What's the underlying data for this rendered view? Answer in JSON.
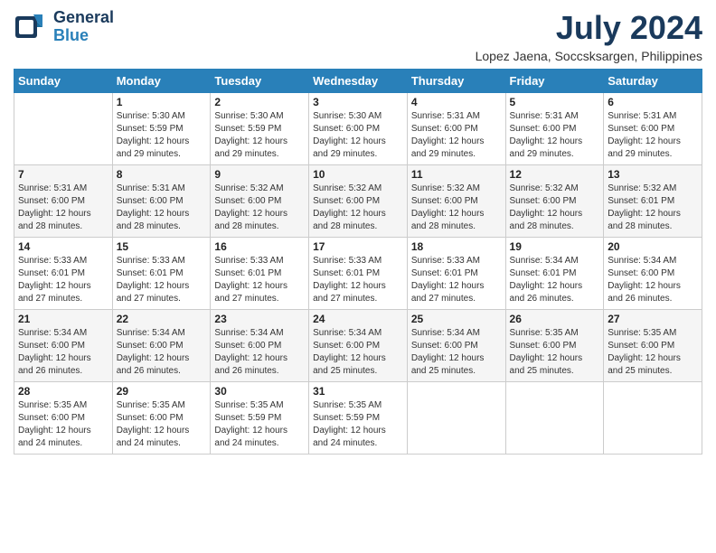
{
  "header": {
    "logo_general": "General",
    "logo_blue": "Blue",
    "month_year": "July 2024",
    "location": "Lopez Jaena, Soccsksargen, Philippines"
  },
  "calendar": {
    "days_of_week": [
      "Sunday",
      "Monday",
      "Tuesday",
      "Wednesday",
      "Thursday",
      "Friday",
      "Saturday"
    ],
    "weeks": [
      [
        {
          "day": "",
          "info": ""
        },
        {
          "day": "1",
          "info": "Sunrise: 5:30 AM\nSunset: 5:59 PM\nDaylight: 12 hours\nand 29 minutes."
        },
        {
          "day": "2",
          "info": "Sunrise: 5:30 AM\nSunset: 5:59 PM\nDaylight: 12 hours\nand 29 minutes."
        },
        {
          "day": "3",
          "info": "Sunrise: 5:30 AM\nSunset: 6:00 PM\nDaylight: 12 hours\nand 29 minutes."
        },
        {
          "day": "4",
          "info": "Sunrise: 5:31 AM\nSunset: 6:00 PM\nDaylight: 12 hours\nand 29 minutes."
        },
        {
          "day": "5",
          "info": "Sunrise: 5:31 AM\nSunset: 6:00 PM\nDaylight: 12 hours\nand 29 minutes."
        },
        {
          "day": "6",
          "info": "Sunrise: 5:31 AM\nSunset: 6:00 PM\nDaylight: 12 hours\nand 29 minutes."
        }
      ],
      [
        {
          "day": "7",
          "info": "Sunrise: 5:31 AM\nSunset: 6:00 PM\nDaylight: 12 hours\nand 28 minutes."
        },
        {
          "day": "8",
          "info": "Sunrise: 5:31 AM\nSunset: 6:00 PM\nDaylight: 12 hours\nand 28 minutes."
        },
        {
          "day": "9",
          "info": "Sunrise: 5:32 AM\nSunset: 6:00 PM\nDaylight: 12 hours\nand 28 minutes."
        },
        {
          "day": "10",
          "info": "Sunrise: 5:32 AM\nSunset: 6:00 PM\nDaylight: 12 hours\nand 28 minutes."
        },
        {
          "day": "11",
          "info": "Sunrise: 5:32 AM\nSunset: 6:00 PM\nDaylight: 12 hours\nand 28 minutes."
        },
        {
          "day": "12",
          "info": "Sunrise: 5:32 AM\nSunset: 6:00 PM\nDaylight: 12 hours\nand 28 minutes."
        },
        {
          "day": "13",
          "info": "Sunrise: 5:32 AM\nSunset: 6:01 PM\nDaylight: 12 hours\nand 28 minutes."
        }
      ],
      [
        {
          "day": "14",
          "info": "Sunrise: 5:33 AM\nSunset: 6:01 PM\nDaylight: 12 hours\nand 27 minutes."
        },
        {
          "day": "15",
          "info": "Sunrise: 5:33 AM\nSunset: 6:01 PM\nDaylight: 12 hours\nand 27 minutes."
        },
        {
          "day": "16",
          "info": "Sunrise: 5:33 AM\nSunset: 6:01 PM\nDaylight: 12 hours\nand 27 minutes."
        },
        {
          "day": "17",
          "info": "Sunrise: 5:33 AM\nSunset: 6:01 PM\nDaylight: 12 hours\nand 27 minutes."
        },
        {
          "day": "18",
          "info": "Sunrise: 5:33 AM\nSunset: 6:01 PM\nDaylight: 12 hours\nand 27 minutes."
        },
        {
          "day": "19",
          "info": "Sunrise: 5:34 AM\nSunset: 6:01 PM\nDaylight: 12 hours\nand 26 minutes."
        },
        {
          "day": "20",
          "info": "Sunrise: 5:34 AM\nSunset: 6:00 PM\nDaylight: 12 hours\nand 26 minutes."
        }
      ],
      [
        {
          "day": "21",
          "info": "Sunrise: 5:34 AM\nSunset: 6:00 PM\nDaylight: 12 hours\nand 26 minutes."
        },
        {
          "day": "22",
          "info": "Sunrise: 5:34 AM\nSunset: 6:00 PM\nDaylight: 12 hours\nand 26 minutes."
        },
        {
          "day": "23",
          "info": "Sunrise: 5:34 AM\nSunset: 6:00 PM\nDaylight: 12 hours\nand 26 minutes."
        },
        {
          "day": "24",
          "info": "Sunrise: 5:34 AM\nSunset: 6:00 PM\nDaylight: 12 hours\nand 25 minutes."
        },
        {
          "day": "25",
          "info": "Sunrise: 5:34 AM\nSunset: 6:00 PM\nDaylight: 12 hours\nand 25 minutes."
        },
        {
          "day": "26",
          "info": "Sunrise: 5:35 AM\nSunset: 6:00 PM\nDaylight: 12 hours\nand 25 minutes."
        },
        {
          "day": "27",
          "info": "Sunrise: 5:35 AM\nSunset: 6:00 PM\nDaylight: 12 hours\nand 25 minutes."
        }
      ],
      [
        {
          "day": "28",
          "info": "Sunrise: 5:35 AM\nSunset: 6:00 PM\nDaylight: 12 hours\nand 24 minutes."
        },
        {
          "day": "29",
          "info": "Sunrise: 5:35 AM\nSunset: 6:00 PM\nDaylight: 12 hours\nand 24 minutes."
        },
        {
          "day": "30",
          "info": "Sunrise: 5:35 AM\nSunset: 5:59 PM\nDaylight: 12 hours\nand 24 minutes."
        },
        {
          "day": "31",
          "info": "Sunrise: 5:35 AM\nSunset: 5:59 PM\nDaylight: 12 hours\nand 24 minutes."
        },
        {
          "day": "",
          "info": ""
        },
        {
          "day": "",
          "info": ""
        },
        {
          "day": "",
          "info": ""
        }
      ]
    ]
  }
}
